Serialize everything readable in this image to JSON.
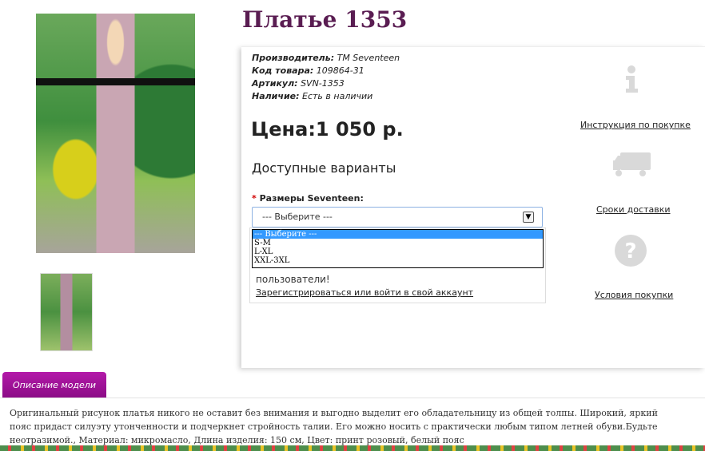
{
  "product": {
    "title": "Платье 1353",
    "manufacturer_label": "Производитель:",
    "manufacturer": "TM Seventeen",
    "code_label": "Код товара:",
    "code": "109864-31",
    "sku_label": "Артикул:",
    "sku": "SVN-1353",
    "availability_label": "Наличие:",
    "availability": "Есть в наличии",
    "price": "Цена:1 050 р."
  },
  "variants": {
    "title": "Доступные варианты",
    "required_mark": "*",
    "size_label": "Размеры Seventeen:",
    "selected": "--- Выберите ---",
    "options": [
      "--- Выберите ---",
      "S-M",
      "L-XL",
      "XXL-3XL"
    ]
  },
  "login": {
    "text": "пользователи!",
    "link": "Зарегистрироваться или войти в свой аккаунт"
  },
  "side_links": [
    {
      "icon": "info-icon",
      "label": "Инструкция по покупке"
    },
    {
      "icon": "truck-icon",
      "label": "Сроки доставки"
    },
    {
      "icon": "question-icon",
      "label": "Условия покупки"
    }
  ],
  "tab": {
    "label": "Описание модели"
  },
  "description": "Оригинальный рисунок платья никого не оставит без внимания и выгодно выделит его обладательницу из общей толпы. Широкий, яркий пояс придаст силуэту утонченности и подчеркнет стройность талии. Его можно носить с практически любым типом летней обуви.Будьте неотразимой., Материал: микромасло, Длина изделия: 150 см, Цвет: принт розовый, белый пояс",
  "colors": {
    "title": "#5a1d52",
    "tab": "#a0139a",
    "selected_option": "#3399ff",
    "icon_gray": "#d9d9d9"
  }
}
